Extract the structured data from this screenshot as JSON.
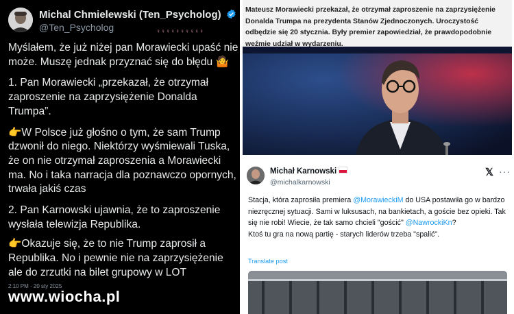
{
  "left_tweet": {
    "author_name": "Michal Chmielewski (Ten_Psycholog)",
    "handle": "@Ten_Psycholog",
    "emoji_row": "♀♀♀♀♀♀♀♀♀♀",
    "paragraphs": [
      "Myślałem, że już niżej pan Morawiecki upaść nie może. Muszę jednak przyznać się do błędu 🤷",
      "1. Pan Morawiecki „przekazał, że otrzymał zaproszenie na zaprzysiężenie Donalda Trumpa”.",
      "👉W Polsce już głośno o tym, że sam Trump dzwonił do niego. Niektórzy wyśmiewali Tuska, że on nie otrzymał zaproszenia a Morawiecki ma. No i taka narracja dla poznawczo opornych, trwała jakiś czas",
      "2. Pan Karnowski ujawnia, że to zaproszenie wysłała telewizja Republika.",
      "👉Okazuje się, że to nie Trump zaprosił a Republika. No i pewnie nie na zaprzysiężenie ale do zrzutki na bilet grupowy w LOT"
    ],
    "timestamp": "2:10 PM · 20 sty 2025"
  },
  "watermark": "www.wiocha.pl",
  "news": {
    "text": "Mateusz Morawiecki przekazał, że otrzymał zaproszenie na zaprzysiężenie Donalda Trumpa na prezydenta Stanów Zjednoczonych. Uroczystość odbędzie się 20 stycznia. Były premier zapowiedział, że prawdopodobnie weźmie udział w wydarzeniu."
  },
  "right_tweet": {
    "author_name": "Michał Karnowski",
    "handle": "@michalkarnowski",
    "logo": "𝕏",
    "more": "···",
    "body": {
      "line1_pre": "Stacja, która zaprosiła premiera ",
      "mention1": "@MorawieckiM",
      "line1_post": " do USA postawiła go w bardzo niezręcznej sytuacji. Sami w luksusach, na bankietach, a goście bez opieki. Tak się nie robi! Wiecie, że tak samo chcieli \"gościć\" ",
      "mention2": "@NawrockiKn",
      "line2_post": "?",
      "line3": "Ktoś tu gra na nową partię - starych liderów trzeba \"spalić\"."
    },
    "translate_label": "Translate post"
  },
  "colors": {
    "dark_bg": "#000000",
    "link_blue": "#1d9bf0",
    "verified_blue": "#1d9bf0"
  }
}
